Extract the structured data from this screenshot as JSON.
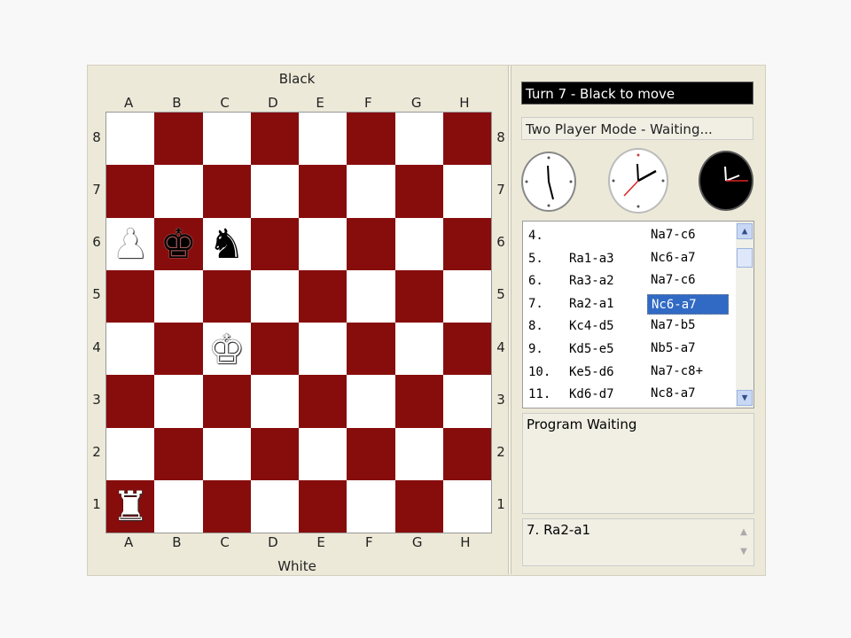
{
  "board": {
    "top_label": "Black",
    "bottom_label": "White",
    "files": [
      "A",
      "B",
      "C",
      "D",
      "E",
      "F",
      "G",
      "H"
    ],
    "ranks": [
      "8",
      "7",
      "6",
      "5",
      "4",
      "3",
      "2",
      "1"
    ],
    "pieces": [
      {
        "square": "a6",
        "type": "pawn",
        "color": "white",
        "glyph": "♟"
      },
      {
        "square": "b6",
        "type": "king",
        "color": "black",
        "glyph": "♚"
      },
      {
        "square": "c6",
        "type": "knight",
        "color": "black",
        "glyph": "♞"
      },
      {
        "square": "c4",
        "type": "king",
        "color": "white",
        "glyph": "♚"
      },
      {
        "square": "a1",
        "type": "rook",
        "color": "white",
        "glyph": "♜"
      }
    ],
    "colors": {
      "dark": "#870d0d",
      "light": "#ffffff"
    }
  },
  "turn_status": "Turn 7 - Black to move",
  "mode_status": "Two Player Mode - Waiting...",
  "clocks": [
    {
      "face": "white",
      "hands": [
        "clock-hand-black"
      ]
    },
    {
      "face": "white",
      "hands": [
        "clock-hand-black",
        "clock-hand-red"
      ]
    },
    {
      "face": "black",
      "hands": [
        "clock-hand-white",
        "clock-hand-red"
      ]
    }
  ],
  "moves": [
    {
      "num": "4.",
      "white": "",
      "black": "Na7-c6"
    },
    {
      "num": "5.",
      "white": "Ra1-a3",
      "black": "Nc6-a7"
    },
    {
      "num": "6.",
      "white": "Ra3-a2",
      "black": "Na7-c6"
    },
    {
      "num": "7.",
      "white": "Ra2-a1",
      "black": "Nc6-a7",
      "selected": true
    },
    {
      "num": "8.",
      "white": "Kc4-d5",
      "black": "Na7-b5"
    },
    {
      "num": "9.",
      "white": "Kd5-e5",
      "black": "Nb5-a7"
    },
    {
      "num": "10.",
      "white": "Ke5-d6",
      "black": "Na7-c8+"
    },
    {
      "num": "11.",
      "white": "Kd6-d7",
      "black": "Nc8-a7"
    }
  ],
  "status_text": "Program Waiting",
  "last_move_text": "7. Ra2-a1",
  "scroll_icons": {
    "up": "chevron-up-icon",
    "down": "chevron-down-icon"
  }
}
